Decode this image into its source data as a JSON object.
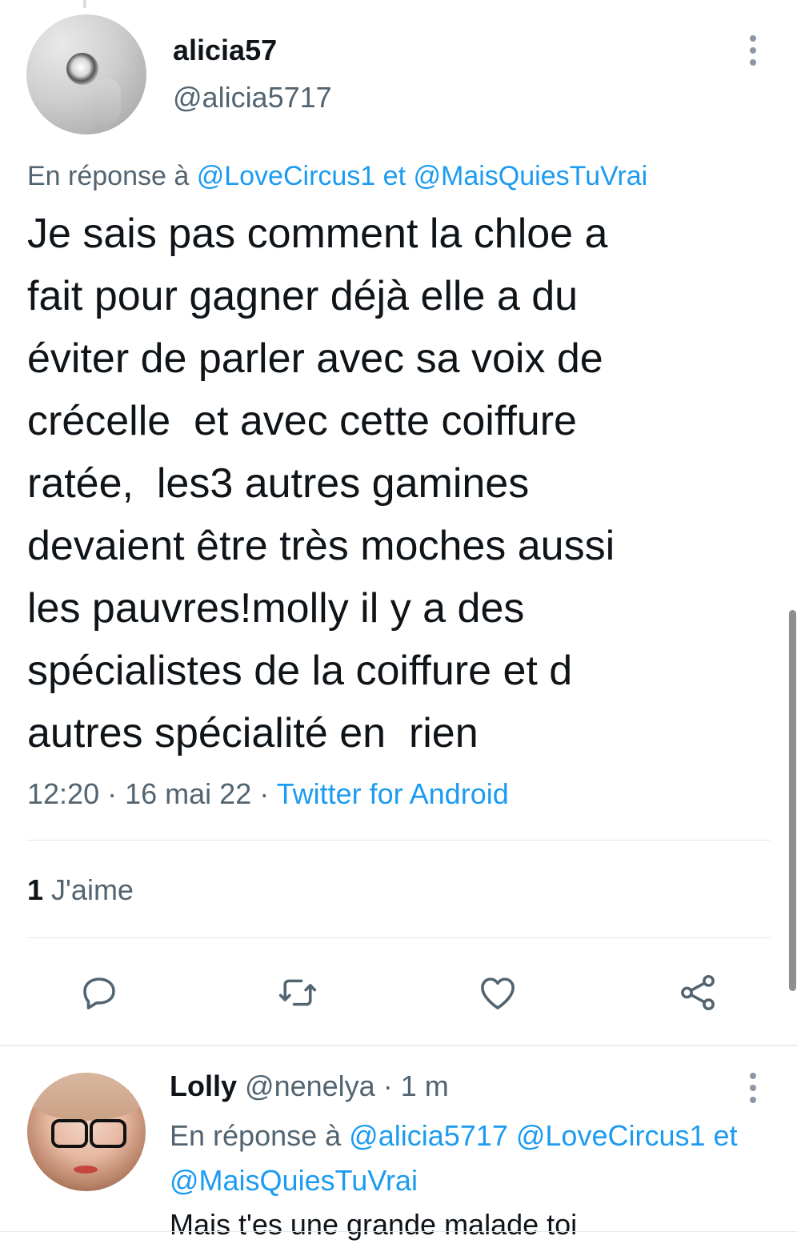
{
  "main_tweet": {
    "display_name": "alicia57",
    "handle": "@alicia5717",
    "reply_to": {
      "prefix": "En réponse à",
      "mention_1": "@LoveCircus1",
      "conjunction": "et",
      "mention_2": "@MaisQuiesTuVrai"
    },
    "text": "Je sais pas comment la chloe a\nfait pour gagner déjà elle a du\néviter de parler avec sa voix de\ncrécelle  et avec cette coiffure\nratée,  les3 autres gamines\ndevaient être très moches aussi\nles pauvres!molly il y a des\nspécialistes de la coiffure et d\nautres spécialité en  rien",
    "time": "12:20",
    "date": "16 mai 22",
    "separator": "·",
    "source": "Twitter for Android",
    "likes_count": "1",
    "likes_label": "J'aime",
    "actions": {
      "reply_icon": "reply-bubble-icon",
      "retweet_icon": "retweet-arrows-icon",
      "like_icon": "heart-icon",
      "share_icon": "share-nodes-icon"
    }
  },
  "reply_tweet": {
    "display_name": "Lolly",
    "handle": "@nenelya",
    "separator": "·",
    "age": "1 m",
    "reply_to": {
      "prefix": "En réponse à",
      "mention_1": "@alicia5717",
      "mention_2": "@LoveCircus1",
      "conjunction": "et",
      "mention_3": "@MaisQuiesTuVrai"
    },
    "text": "Mais t'es une grande malade toi"
  },
  "colors": {
    "link": "#1d9bf0",
    "secondary_text": "#536471",
    "primary_text": "#0f1419",
    "divider": "#e1e8ed"
  }
}
